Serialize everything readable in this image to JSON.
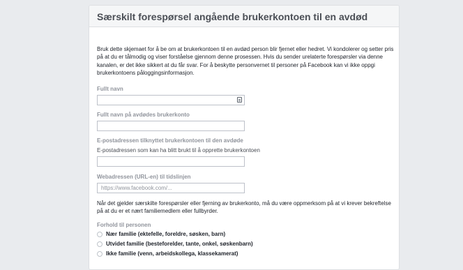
{
  "form": {
    "title": "Særskilt forespørsel angående brukerkontoen til en avdød",
    "intro": "Bruk dette skjemaet for å be om at brukerkontoen til en avdød person blir fjernet eller hedret. Vi kondolerer og setter pris på at du er tålmodig og viser forståelse gjennom denne prosessen. Hvis du sender urelaterte forespørsler via denne kanalen, er det ikke sikkert at du får svar. For å beskytte personvernet til personer på Facebook kan vi ikke oppgi brukerkontoens påloggingsinformasjon.",
    "full_name": {
      "label": "Fullt navn",
      "value": ""
    },
    "deceased_name": {
      "label": "Fullt navn på avdødes brukerkonto",
      "value": ""
    },
    "email": {
      "label": "E-postadressen tilknyttet brukerkontoen til den avdøde",
      "sublabel": "E-postadressen som kan ha blitt brukt til å opprette brukerkontoen",
      "value": ""
    },
    "timeline_url": {
      "label": "Webadressen (URL-en) til tidslinjen",
      "placeholder": "https://www.facebook.com/..."
    },
    "note": "Når det gjelder særskilte forespørsler eller fjerning av brukerkonto, må du være oppmerksom på at vi krever bekreftelse på at du er et nært familiemedlem eller fullbyrder.",
    "relation": {
      "label": "Forhold til personen",
      "options": [
        "Nær familie (ektefelle, foreldre, søsken, barn)",
        "Utvidet familie (besteforelder, tante, onkel, søskenbarn)",
        "Ikke familie (venn, arbeidskollega, klassekamerat)"
      ]
    }
  },
  "colors": {
    "page_background": "#e9ebee",
    "header_background": "#f5f6f7",
    "label_gray": "#90949c",
    "border": "#dddfe2"
  },
  "icons": {
    "full_name_field": "contact-card-icon"
  }
}
